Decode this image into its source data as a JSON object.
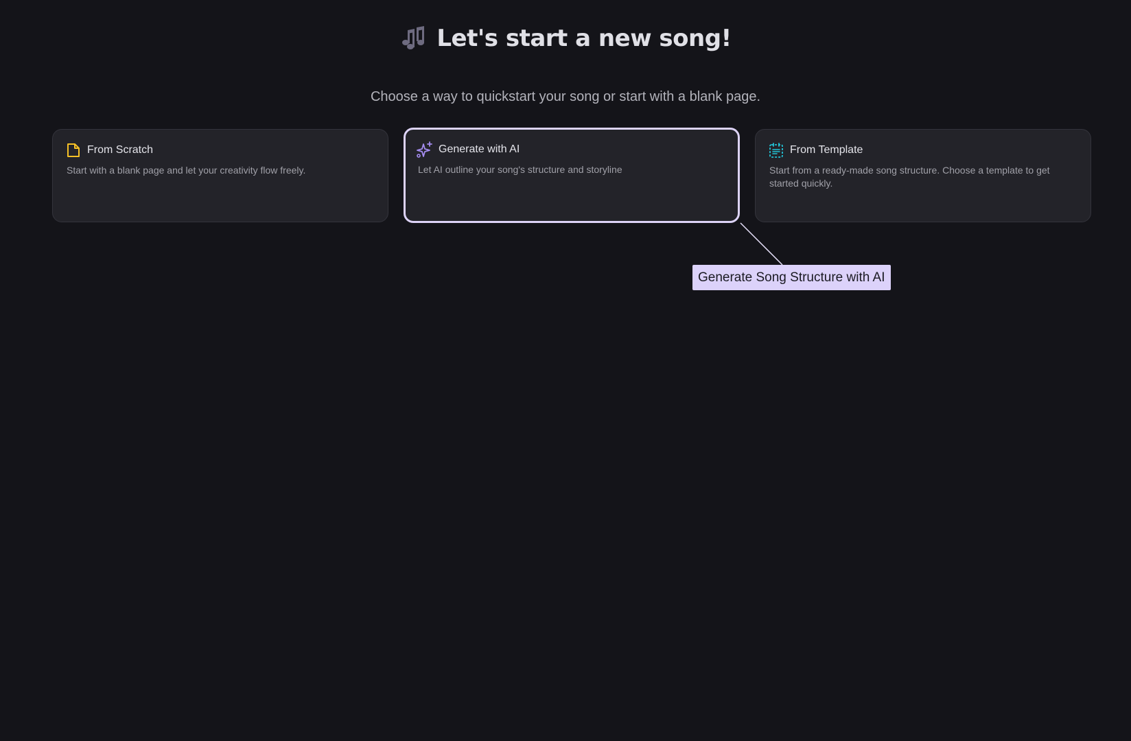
{
  "header": {
    "icon": "music-notes-icon",
    "title": "Let's start a new song!"
  },
  "subtitle": "Choose a way to quickstart your song or start with a blank page.",
  "cards": [
    {
      "icon": "blank-page-icon",
      "title": "From Scratch",
      "description": "Start with a blank page and let your creativity flow freely.",
      "icon_color": "#f5c026"
    },
    {
      "icon": "ai-sparkles-icon",
      "title": "Generate with AI",
      "description": "Let AI outline your song's structure and storyline",
      "icon_color": "#a48cf0",
      "selected": true
    },
    {
      "icon": "template-icon",
      "title": "From Template",
      "description": "Start from a ready-made song structure. Choose a template to get started quickly.",
      "icon_color": "#22c3d6"
    }
  ],
  "tooltip": {
    "text": "Generate Song Structure with AI"
  },
  "colors": {
    "background": "#141419",
    "card_background": "#232329",
    "selected_border": "#ddd3f7",
    "tooltip_background": "#dcd2fa"
  }
}
